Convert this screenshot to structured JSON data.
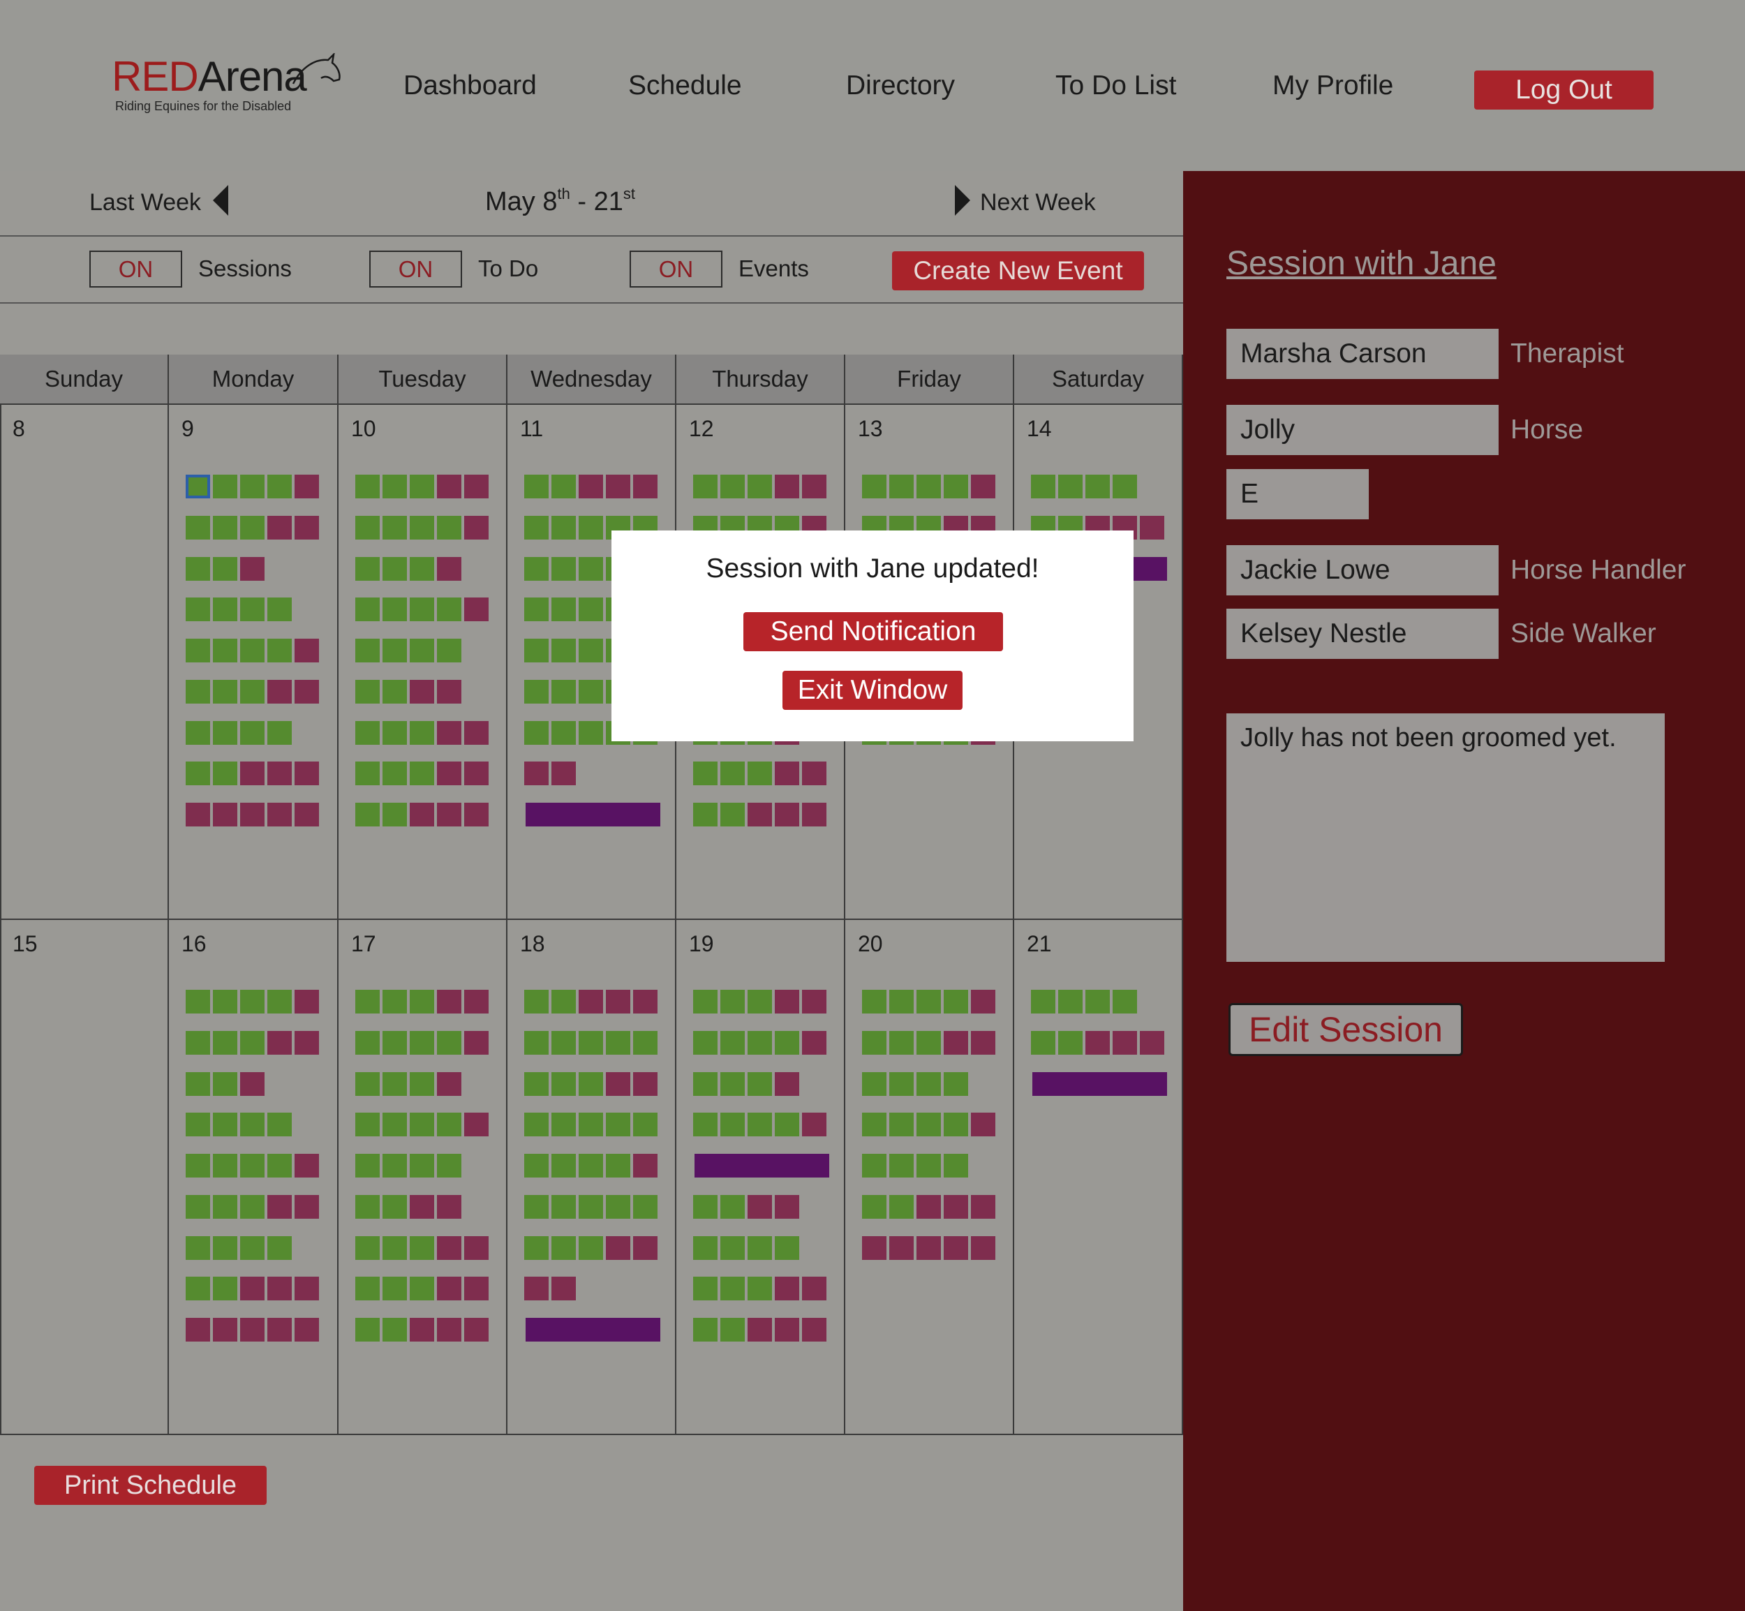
{
  "logo": {
    "brand_red": "RED",
    "brand_dark": "Arena",
    "tagline": "Riding Equines for the Disabled"
  },
  "nav": {
    "dashboard": "Dashboard",
    "schedule": "Schedule",
    "directory": "Directory",
    "todo": "To Do List",
    "profile": "My Profile",
    "logout": "Log Out"
  },
  "week": {
    "last": "Last Week",
    "next": "Next Week",
    "range_start": "May 8",
    "range_start_sup": "th",
    "range_sep": " - 21",
    "range_end_sup": "st"
  },
  "filters": {
    "sessions": {
      "state": "ON",
      "label": "Sessions"
    },
    "todo": {
      "state": "ON",
      "label": "To Do"
    },
    "events": {
      "state": "ON",
      "label": "Events"
    },
    "create": "Create New Event"
  },
  "calendar": {
    "days": [
      "Sunday",
      "Monday",
      "Tuesday",
      "Wednesday",
      "Thursday",
      "Friday",
      "Saturday"
    ],
    "weeks": [
      [
        {
          "date": "8",
          "rows": []
        },
        {
          "date": "9",
          "rows": [
            "ggggm",
            "gggmm",
            "ggm",
            "gggg",
            "ggggm",
            "gggmm",
            "gggg",
            "ggmmm",
            "mmmmm"
          ]
        },
        {
          "date": "10",
          "rows": [
            "gggmm",
            "ggggm",
            "gggm",
            "ggggm",
            "gggg",
            "ggmm",
            "gggmm",
            "gggmm",
            "ggmmm"
          ]
        },
        {
          "date": "11",
          "rows": [
            "ggmmm",
            "ggggg",
            "ggggg",
            "ggggg",
            "ggggg",
            "ggggg",
            "ggggg",
            "mm",
            "B"
          ]
        },
        {
          "date": "12",
          "rows": [
            "gggmm",
            "ggggm",
            "gggg",
            "gggg",
            "gggg",
            "gggg",
            "gggm",
            "gggmm",
            "ggmmm"
          ]
        },
        {
          "date": "13",
          "rows": [
            "ggggm",
            "gggmm",
            "gggg",
            "gggg",
            "gggg",
            "gggg",
            "ggggm"
          ]
        },
        {
          "date": "14",
          "rows": [
            "gggg",
            "ggmmm",
            "B"
          ]
        }
      ],
      [
        {
          "date": "15",
          "rows": []
        },
        {
          "date": "16",
          "rows": [
            "ggggm",
            "gggmm",
            "ggm",
            "gggg",
            "ggggm",
            "gggmm",
            "gggg",
            "ggmmm",
            "mmmmm"
          ]
        },
        {
          "date": "17",
          "rows": [
            "gggmm",
            "ggggm",
            "gggm",
            "ggggm",
            "gggg",
            "ggmm",
            "gggmm",
            "gggmm",
            "ggmmm"
          ]
        },
        {
          "date": "18",
          "rows": [
            "ggmmm",
            "ggggg",
            "gggmm",
            "ggggg",
            "ggggm",
            "ggggg",
            "gggmm",
            "mm",
            "B"
          ]
        },
        {
          "date": "19",
          "rows": [
            "gggmm",
            "ggggm",
            "gggm",
            "ggggm",
            "B",
            "ggmm",
            "gggg",
            "gggmm",
            "ggmmm"
          ]
        },
        {
          "date": "20",
          "rows": [
            "ggggm",
            "gggmm",
            "gggg",
            "ggggm",
            "gggg",
            "ggmmm",
            "mmmmm"
          ]
        },
        {
          "date": "21",
          "rows": [
            "gggg",
            "ggmmm",
            "B"
          ]
        }
      ]
    ]
  },
  "print": "Print Schedule",
  "panel": {
    "title": "Session with Jane ",
    "therapist": {
      "value": "Marsha Carson",
      "role": "Therapist"
    },
    "horse": {
      "value": "Jolly",
      "role": "Horse",
      "tack": "E"
    },
    "handler": {
      "value": "Jackie Lowe",
      "role": "Horse Handler"
    },
    "walker": {
      "value": "Kelsey Nestle",
      "role": "Side Walker"
    },
    "notes": "Jolly has not been groomed yet.",
    "edit": "Edit Session"
  },
  "modal": {
    "message": "Session with Jane updated!",
    "send": "Send Notification",
    "exit": "Exit Window"
  },
  "colors": {
    "session_green": "#558b2f",
    "todo_maroon": "#7f2d4e",
    "event_purple": "#581263",
    "accent_red": "#a9232a",
    "panel_bg": "#510f12"
  }
}
